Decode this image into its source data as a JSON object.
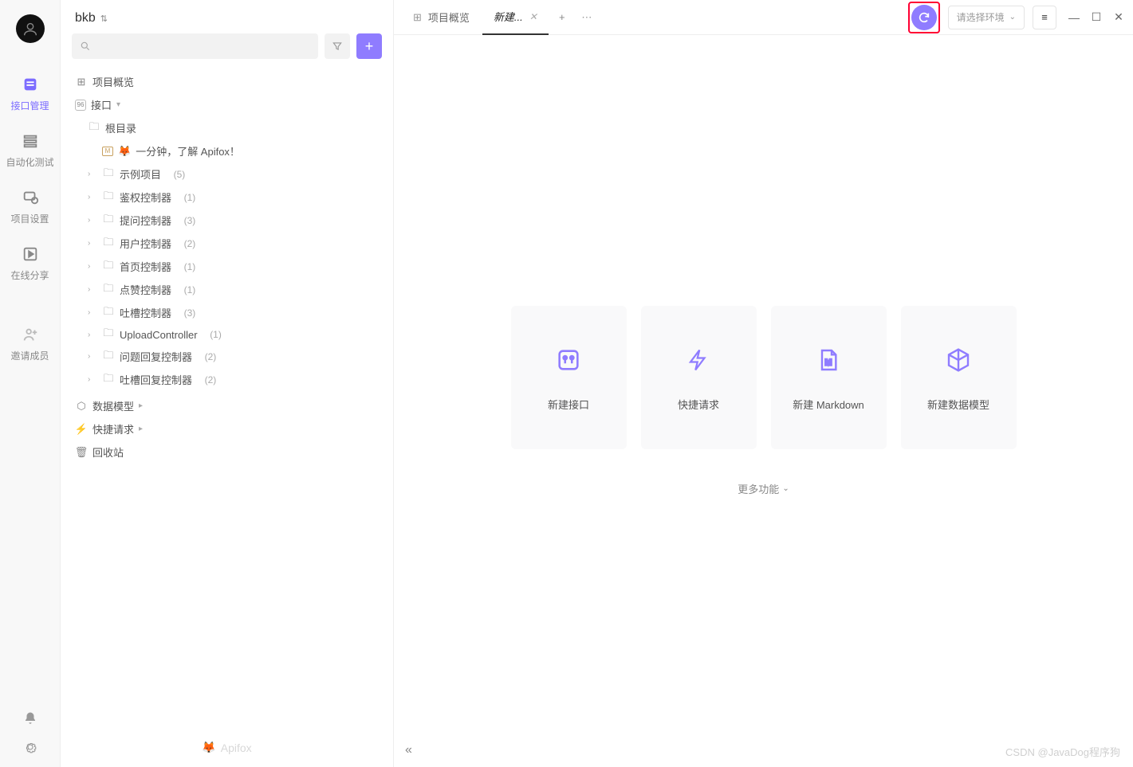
{
  "project": {
    "name": "bkb"
  },
  "rail": {
    "items": [
      {
        "label": "接口管理"
      },
      {
        "label": "自动化测试"
      },
      {
        "label": "项目设置"
      },
      {
        "label": "在线分享"
      },
      {
        "label": "邀请成员"
      }
    ]
  },
  "search": {
    "placeholder": ""
  },
  "tree": {
    "overview": "项目概览",
    "api_section": "接口",
    "root": "根目录",
    "intro": "一分钟，了解 Apifox！",
    "folders": [
      {
        "name": "示例项目",
        "count": "(5)"
      },
      {
        "name": "鉴权控制器",
        "count": "(1)"
      },
      {
        "name": "提问控制器",
        "count": "(3)"
      },
      {
        "name": "用户控制器",
        "count": "(2)"
      },
      {
        "name": "首页控制器",
        "count": "(1)"
      },
      {
        "name": "点赞控制器",
        "count": "(1)"
      },
      {
        "name": "吐槽控制器",
        "count": "(3)"
      },
      {
        "name": "UploadController",
        "count": "(1)"
      },
      {
        "name": "问题回复控制器",
        "count": "(2)"
      },
      {
        "name": "吐槽回复控制器",
        "count": "(2)"
      }
    ],
    "data_model": "数据模型",
    "quick_request": "快捷请求",
    "recycle": "回收站",
    "brand": "Apifox"
  },
  "tabs": {
    "overview": "项目概览",
    "new": "新建..."
  },
  "env": {
    "placeholder": "请选择环境"
  },
  "cards": [
    {
      "label": "新建接口"
    },
    {
      "label": "快捷请求"
    },
    {
      "label": "新建 Markdown"
    },
    {
      "label": "新建数据模型"
    }
  ],
  "more_fn": "更多功能",
  "watermark": "CSDN @JavaDog程序狗"
}
